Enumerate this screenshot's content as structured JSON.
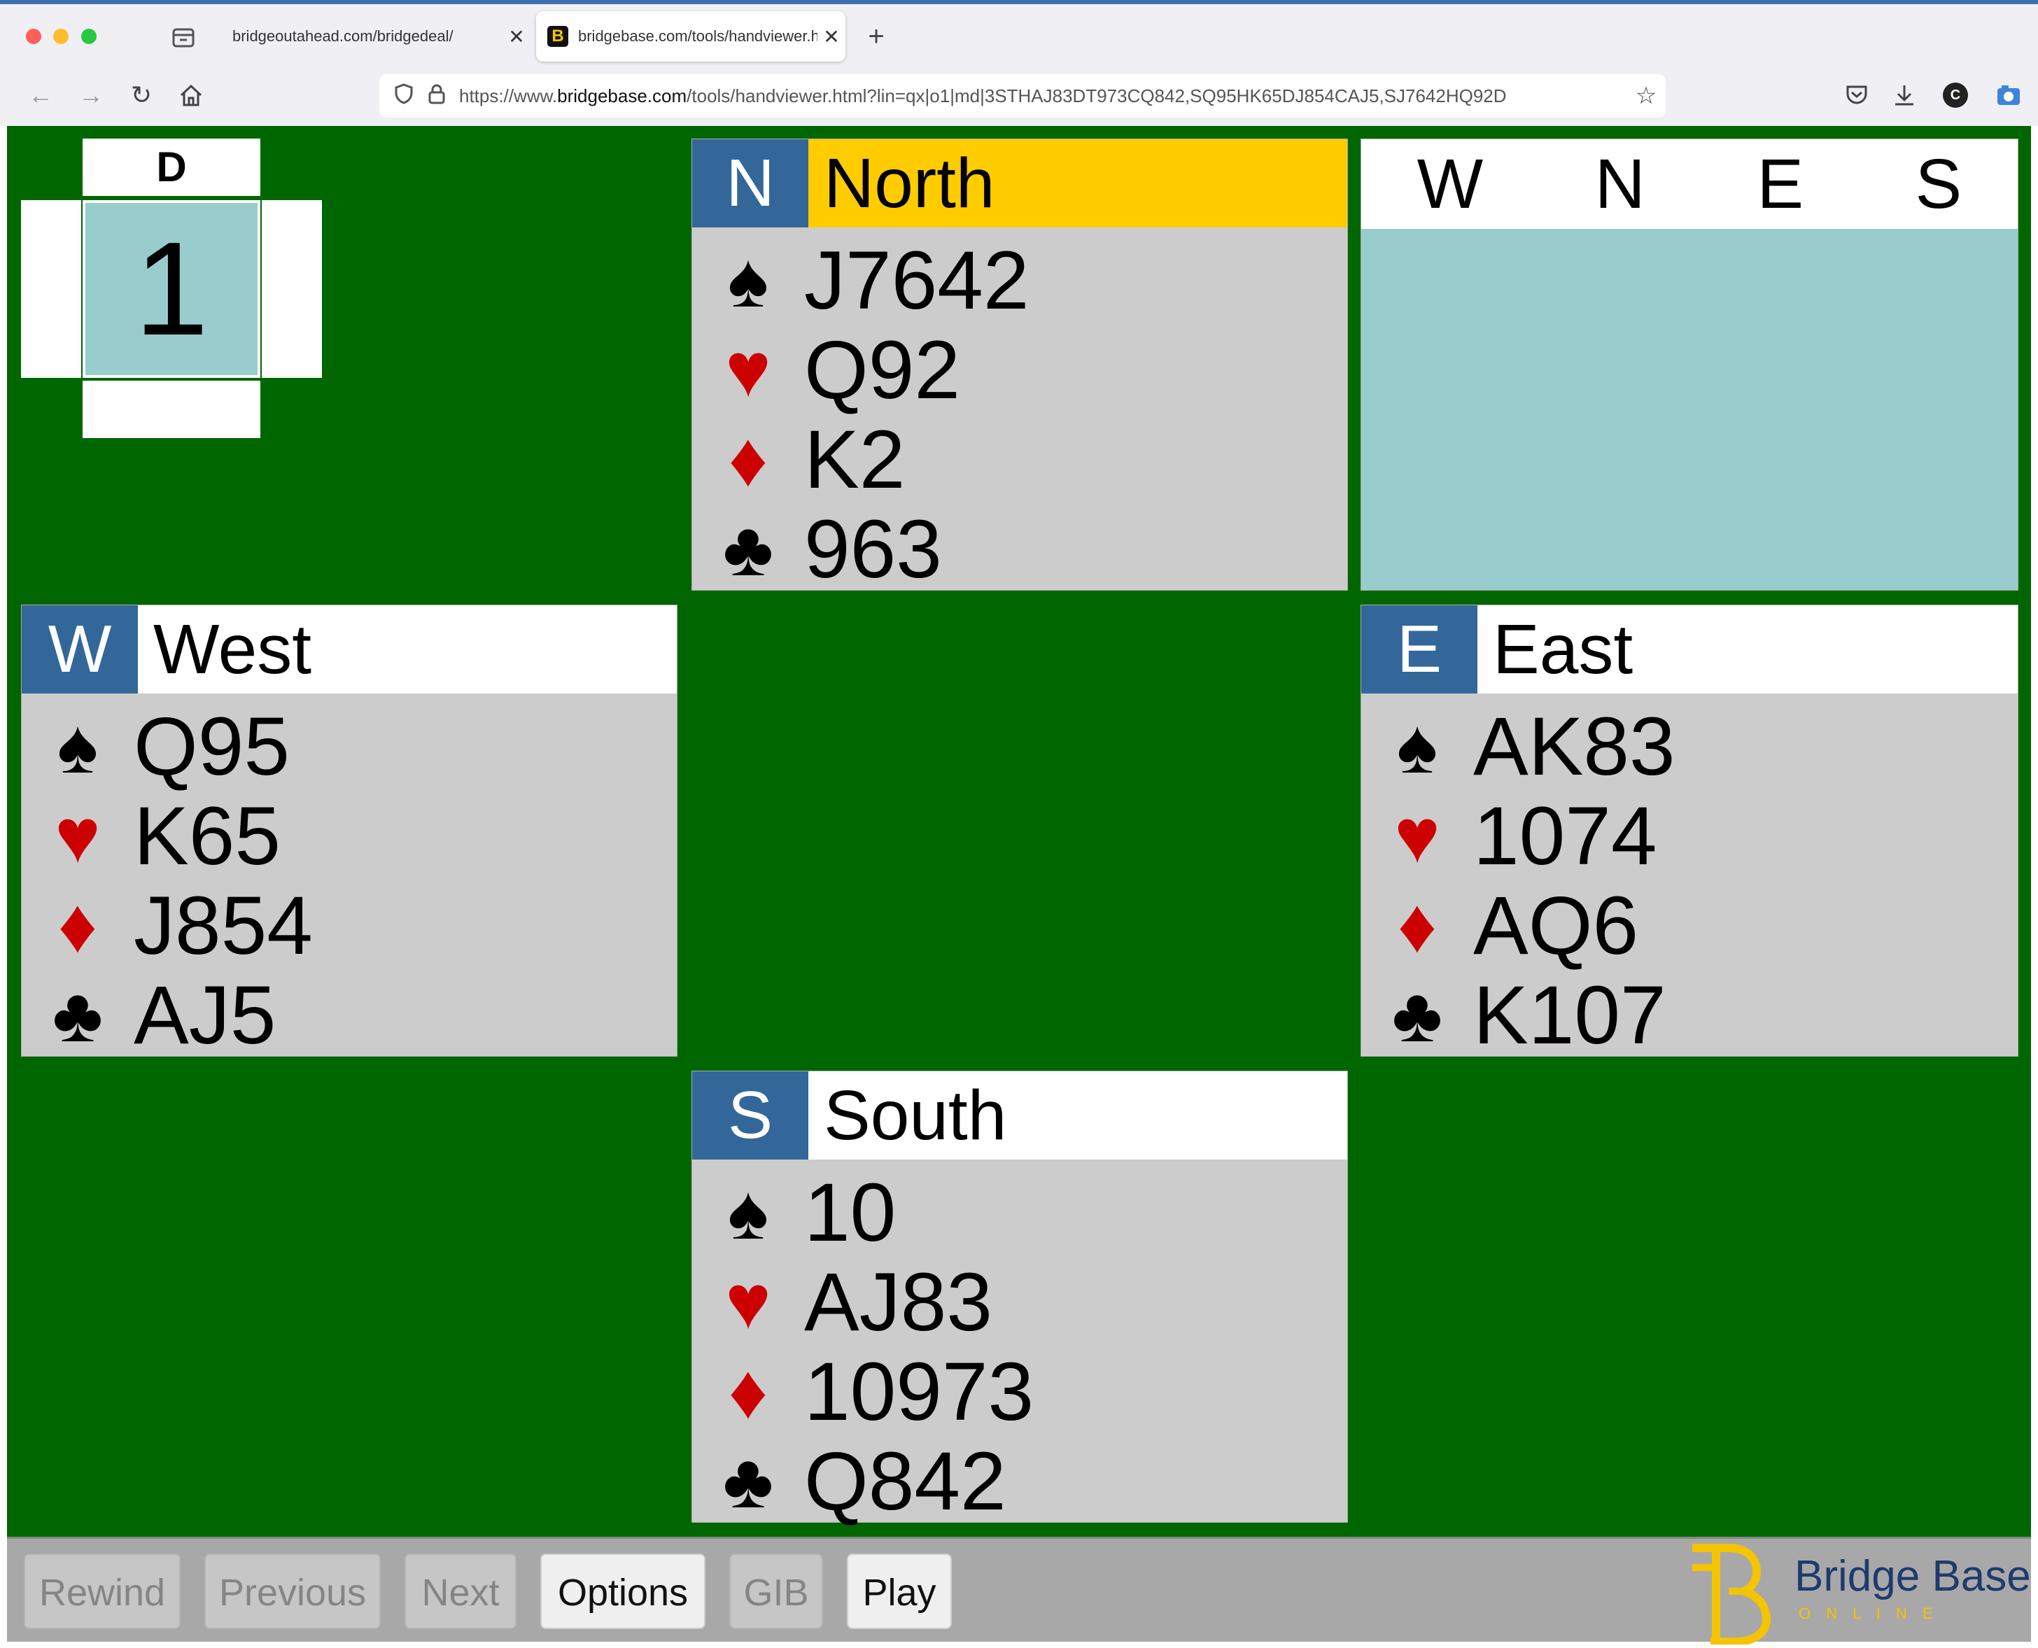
{
  "browser": {
    "tabs": [
      {
        "label": "bridgeoutahead.com/bridgedeal/",
        "active": false
      },
      {
        "label": "bridgebase.com/tools/handviewer.html",
        "active": true
      }
    ],
    "new_tab": "+",
    "url_prefix": "https://www.",
    "url_domain": "bridgebase.com",
    "url_rest": "/tools/handviewer.html?lin=qx|o1|md|3STHAJ83DT973CQ842,SQ95HK65DJ854CAJ5,SJ7642HQ92D",
    "account_initial": "C"
  },
  "board": {
    "dealer_label": "D",
    "board_number": "1",
    "background": "#006600",
    "bidding": {
      "headers": [
        "W",
        "N",
        "E",
        "S"
      ]
    },
    "hands": {
      "north": {
        "letter": "N",
        "name": "North",
        "spades": "J7642",
        "hearts": "Q92",
        "diamonds": "K2",
        "clubs": "963",
        "highlight": "#ffcc00"
      },
      "west": {
        "letter": "W",
        "name": "West",
        "spades": "Q95",
        "hearts": "K65",
        "diamonds": "J854",
        "clubs": "AJ5"
      },
      "east": {
        "letter": "E",
        "name": "East",
        "spades": "AK83",
        "hearts": "1074",
        "diamonds": "AQ6",
        "clubs": "K107"
      },
      "south": {
        "letter": "S",
        "name": "South",
        "spades": "10",
        "hearts": "AJ83",
        "diamonds": "10973",
        "clubs": "Q842"
      }
    },
    "suits": {
      "spade": "♠",
      "heart": "♥",
      "diamond": "♦",
      "club": "♣"
    }
  },
  "toolbar": {
    "rewind": "Rewind",
    "previous": "Previous",
    "next": "Next",
    "options": "Options",
    "gib": "GIB",
    "play": "Play"
  },
  "logo": {
    "line1": "Bridge Base",
    "line2": "O N L I N E"
  }
}
